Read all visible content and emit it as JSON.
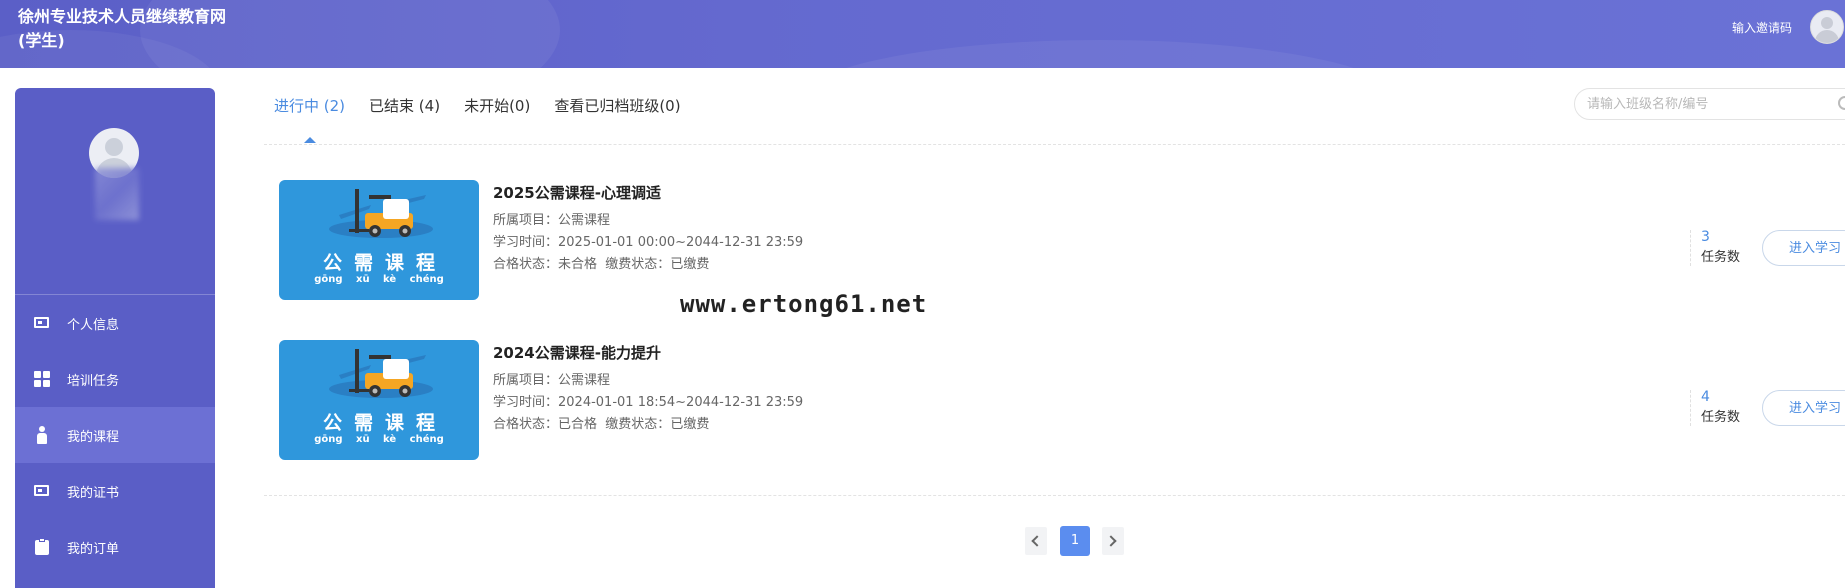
{
  "header": {
    "site_title": "徐州专业技术人员继续教育网(学生)",
    "invite_label": "输入邀请码"
  },
  "sidebar": {
    "items": [
      {
        "label": "个人信息",
        "icon": "id-card-icon",
        "active": false
      },
      {
        "label": "培训任务",
        "icon": "grid-icon",
        "active": false
      },
      {
        "label": "我的课程",
        "icon": "person-icon",
        "active": true
      },
      {
        "label": "我的证书",
        "icon": "certificate-icon",
        "active": false
      },
      {
        "label": "我的订单",
        "icon": "clipboard-icon",
        "active": false
      }
    ]
  },
  "tabs": [
    {
      "label": "进行中 (2)",
      "active": true
    },
    {
      "label": "已结束 (4)",
      "active": false
    },
    {
      "label": "未开始(0)",
      "active": false
    },
    {
      "label": "查看已归档班级(0)",
      "active": false
    }
  ],
  "search": {
    "placeholder": "请输入班级名称/编号"
  },
  "courses": [
    {
      "thumb_title": "公需课程",
      "thumb_pinyin": "gōng xū kè chéng",
      "name": "2025公需课程-心理调适",
      "project_label": "所属项目：",
      "project_value": "公需课程",
      "time_label": "学习时间：",
      "time_value": "2025-01-01 00:00~2044-12-31 23:59",
      "status_label": "合格状态：",
      "status_value": "未合格",
      "pay_label": "缴费状态：",
      "pay_value": "已缴费",
      "task_count": "3",
      "task_label": "任务数",
      "enter_label": "进入学习"
    },
    {
      "thumb_title": "公需课程",
      "thumb_pinyin": "gōng xū kè chéng",
      "name": "2024公需课程-能力提升",
      "project_label": "所属项目：",
      "project_value": "公需课程",
      "time_label": "学习时间：",
      "time_value": "2024-01-01 18:54~2044-12-31 23:59",
      "status_label": "合格状态：",
      "status_value": "已合格",
      "pay_label": "缴费状态：",
      "pay_value": "已缴费",
      "task_count": "4",
      "task_label": "任务数",
      "enter_label": "进入学习"
    }
  ],
  "pagination": {
    "current": "1"
  },
  "watermark": "www.ertong61.net",
  "colors": {
    "header_bg": "#5b5fc7",
    "sidebar_bg": "#5a5ec6",
    "sidebar_active": "#6c70d4",
    "accent": "#4a8be0",
    "thumb_bg": "#2f97dc",
    "page_active": "#5b8def"
  }
}
